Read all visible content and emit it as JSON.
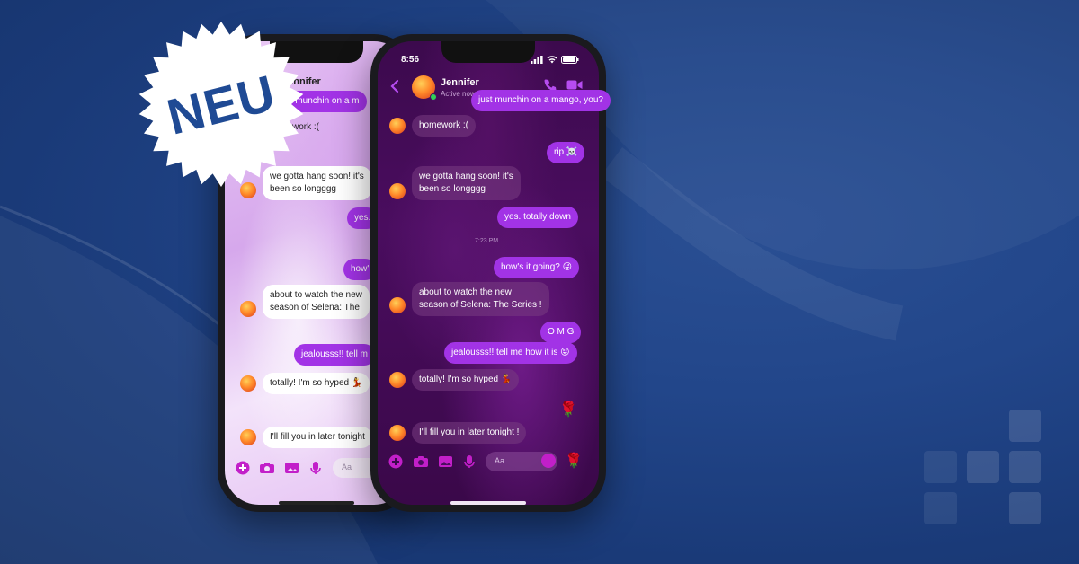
{
  "badge": {
    "text": "NEU"
  },
  "front": {
    "status_time": "8:56",
    "contact_name": "Jennifer",
    "contact_status": "Active now",
    "messages": [
      {
        "dir": "out",
        "text": "just munchin on a mango, you?"
      },
      {
        "dir": "in",
        "text": "homework :("
      },
      {
        "dir": "out",
        "text": "rip ☠️"
      },
      {
        "dir": "in",
        "line1": "we gotta hang soon! it's",
        "line2": "been so longggg"
      },
      {
        "dir": "out",
        "text": "yes. totally down"
      },
      {
        "dir": "out",
        "text": "how's it going? 😜"
      },
      {
        "dir": "in",
        "line1": "about to watch the new",
        "line2": "season of Selena: The Series !"
      },
      {
        "dir": "out",
        "text": "O M G"
      },
      {
        "dir": "out",
        "text": "jealousss!! tell me how it is 😝"
      },
      {
        "dir": "in",
        "text": "totally! I'm so hyped 💃"
      },
      {
        "dir": "out",
        "text": "🌹"
      },
      {
        "dir": "in",
        "text": "I'll fill you in later tonight !"
      }
    ],
    "timestamp": "7:23 PM",
    "composer_placeholder": "Aa",
    "quick_reaction": "🌹"
  },
  "back": {
    "contact_name_partial": "Jennifer",
    "messages": [
      {
        "dir": "out",
        "text": "just munchin on a m"
      },
      {
        "dir": "in",
        "text": "homework :("
      },
      {
        "dir": "in",
        "line1": "we gotta hang soon! it's",
        "line2": "been so longggg"
      },
      {
        "dir": "out",
        "text": "yes."
      },
      {
        "dir": "out",
        "text": "how'"
      },
      {
        "dir": "in",
        "line1": "about to watch the new",
        "line2": "season of Selena: The"
      },
      {
        "dir": "out",
        "text": "jealousss!! tell m"
      },
      {
        "dir": "in",
        "text": "totally! I'm so hyped 💃"
      },
      {
        "dir": "in",
        "text": "I'll fill you in later tonight"
      }
    ],
    "composer_placeholder": "Aa"
  },
  "colors": {
    "accent": "#a233e6",
    "badge_text": "#1f4a94",
    "background": "#22468a"
  }
}
